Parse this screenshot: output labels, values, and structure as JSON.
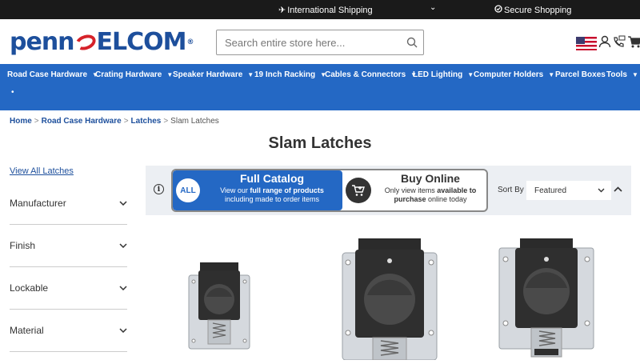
{
  "topbar": {
    "shipping_label": "International Shipping",
    "secure_label": "Secure Shopping"
  },
  "header": {
    "logo_left": "penn",
    "logo_right": "elcom",
    "logo_reg": "®",
    "search_placeholder": "Search entire store here..."
  },
  "nav": {
    "items": [
      {
        "label": "Road Case Hardware"
      },
      {
        "label": "Crating Hardware"
      },
      {
        "label": "Speaker Hardware"
      },
      {
        "label": "19 Inch Racking"
      },
      {
        "label": "Cables & Connectors"
      },
      {
        "label": "LED Lighting"
      },
      {
        "label": "Computer Holders"
      },
      {
        "label": "Parcel Boxes"
      },
      {
        "label": "Tools"
      }
    ]
  },
  "breadcrumb": {
    "home": "Home",
    "road_case": "Road Case Hardware",
    "latches": "Latches",
    "current": "Slam Latches",
    "separator": ">"
  },
  "page": {
    "title": "Slam Latches"
  },
  "sidebar": {
    "view_all": "View All Latches",
    "facets": [
      {
        "label": "Manufacturer"
      },
      {
        "label": "Finish"
      },
      {
        "label": "Lockable"
      },
      {
        "label": "Material"
      }
    ]
  },
  "toolbar": {
    "full_catalog": {
      "badge": "ALL",
      "title": "Full Catalog",
      "line1_pre": "View our ",
      "line1_bold": "full range of products",
      "line2": "including made to order items"
    },
    "buy_online": {
      "title": "Buy Online",
      "line1_pre": "Only view items ",
      "line1_bold": "available to",
      "line2_bold": "purchase",
      "line2_post": " online today"
    },
    "sort_label": "Sort By",
    "sort_value": "Featured"
  },
  "colors": {
    "nav_bg": "#2468c4",
    "topbar_bg": "#1a1a1a",
    "link": "#1d4f9c",
    "brand_red": "#d6222a"
  }
}
